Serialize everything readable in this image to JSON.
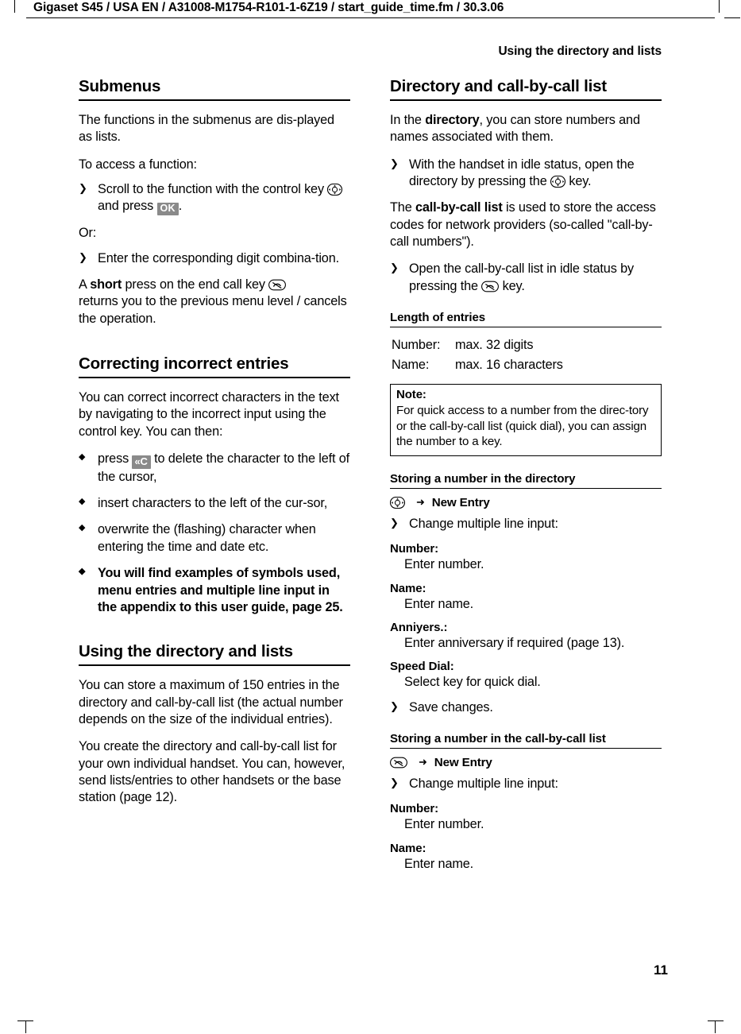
{
  "header": {
    "path": "Gigaset S45 / USA EN / A31008-M1754-R101-1-6Z19 / start_guide_time.fm / 30.3.06",
    "running_head": "Using the directory and lists",
    "page_number": "11"
  },
  "icons": {
    "nav_key": "control-key-icon",
    "end_call_key": "end-call-key-icon",
    "directory_key": "directory-key-icon",
    "call_by_call_key": "call-by-call-key-icon",
    "ok_key": "OK",
    "delete_key": "«C"
  },
  "left_column": {
    "submenus": {
      "heading": "Submenus",
      "p1": "The functions in the submenus are dis-played as lists.",
      "p2": "To access a function:",
      "step1_a": "Scroll to the function with the control key ",
      "step1_b": " and press ",
      "step1_c": ".",
      "or_label": "Or:",
      "step2": "Enter the corresponding digit combina-tion.",
      "p3_a": "A ",
      "p3_bold": "short",
      "p3_b": " press on the end call key ",
      "p3_c": "returns you to the previous menu level / cancels the operation."
    },
    "correcting": {
      "heading": "Correcting incorrect entries",
      "p1": "You can correct incorrect characters in the text by navigating to the incorrect input using the control key. You can then:",
      "b1_a": "press ",
      "b1_b": " to delete the character to the left of the cursor,",
      "b2": "insert characters to the left of the cur-sor,",
      "b3": "overwrite the (flashing) character when entering the time and date etc.",
      "b4": "You will find examples of symbols used, menu entries and multiple line input in the appendix to this user guide, page 25."
    },
    "using_dir": {
      "heading": "Using the directory and lists",
      "p1": "You can store a maximum of 150 entries in the directory and call-by-call list (the actual number depends on the size of the individual entries).",
      "p2": "You create the directory and call-by-call list for your own individual handset. You can, however, send lists/entries to other handsets or the base station (page 12)."
    }
  },
  "right_column": {
    "dir_list": {
      "heading": "Directory and call-by-call list",
      "p1_a": "In the ",
      "p1_bold": "directory",
      "p1_b": ", you can store numbers and names associated with them.",
      "step1_a": "With the handset in idle status, open the directory by pressing the ",
      "step1_b": " key.",
      "p2_a": "The ",
      "p2_bold": "call-by-call list",
      "p2_b": " is used to store the access codes for network providers (so-called \"call-by-call numbers\").",
      "step2_a": "Open the call-by-call list in idle status by pressing the ",
      "step2_b": " key."
    },
    "length": {
      "heading": "Length of entries",
      "rows": [
        {
          "key": "Number:",
          "value": "max. 32 digits"
        },
        {
          "key": "Name:",
          "value": "max. 16 characters"
        }
      ],
      "note_title": "Note:",
      "note_body": "For quick access to a number from the direc-tory or the call-by-call list (quick dial), you can assign the number to a key."
    },
    "store_dir": {
      "heading": "Storing a number in the directory",
      "menu_label": "New Entry",
      "step1": "Change multiple line input:",
      "fields": [
        {
          "label": "Number:",
          "value": "Enter number."
        },
        {
          "label": "Name:",
          "value": "Enter name."
        },
        {
          "label": "Anniyers.:",
          "value": "Enter anniversary if required (page 13)."
        },
        {
          "label": "Speed Dial:",
          "value": "Select key for quick dial."
        }
      ],
      "step2": "Save changes."
    },
    "store_cbc": {
      "heading": "Storing a number in the call-by-call list",
      "menu_label": "New Entry",
      "step1": "Change multiple line input:",
      "fields": [
        {
          "label": "Number:",
          "value": "Enter number."
        },
        {
          "label": "Name:",
          "value": "Enter name."
        }
      ]
    }
  },
  "markers": {
    "arrow": "❯",
    "diamond": "◆",
    "bigarrow": "➜"
  }
}
